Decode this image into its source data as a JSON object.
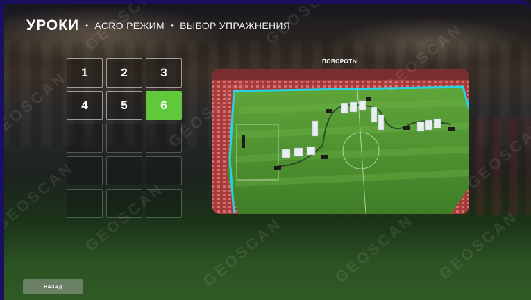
{
  "header": {
    "title": "УРОКИ",
    "breadcrumbs": [
      "ACRO РЕЖИМ",
      "ВЫБОР УПРАЖНЕНИЯ"
    ],
    "separator": "•"
  },
  "lessons": {
    "items": [
      "1",
      "2",
      "3",
      "4",
      "5",
      "6"
    ],
    "selected": "6",
    "total_slots": 15
  },
  "preview": {
    "label": "ПОВОРОТЫ"
  },
  "back_button": {
    "label": "НАЗАД"
  },
  "watermark": "GEOSCAN",
  "colors": {
    "accent_green": "#62c83b",
    "frame_blue": "#1a1060",
    "cyan_border": "#28d2e6"
  }
}
